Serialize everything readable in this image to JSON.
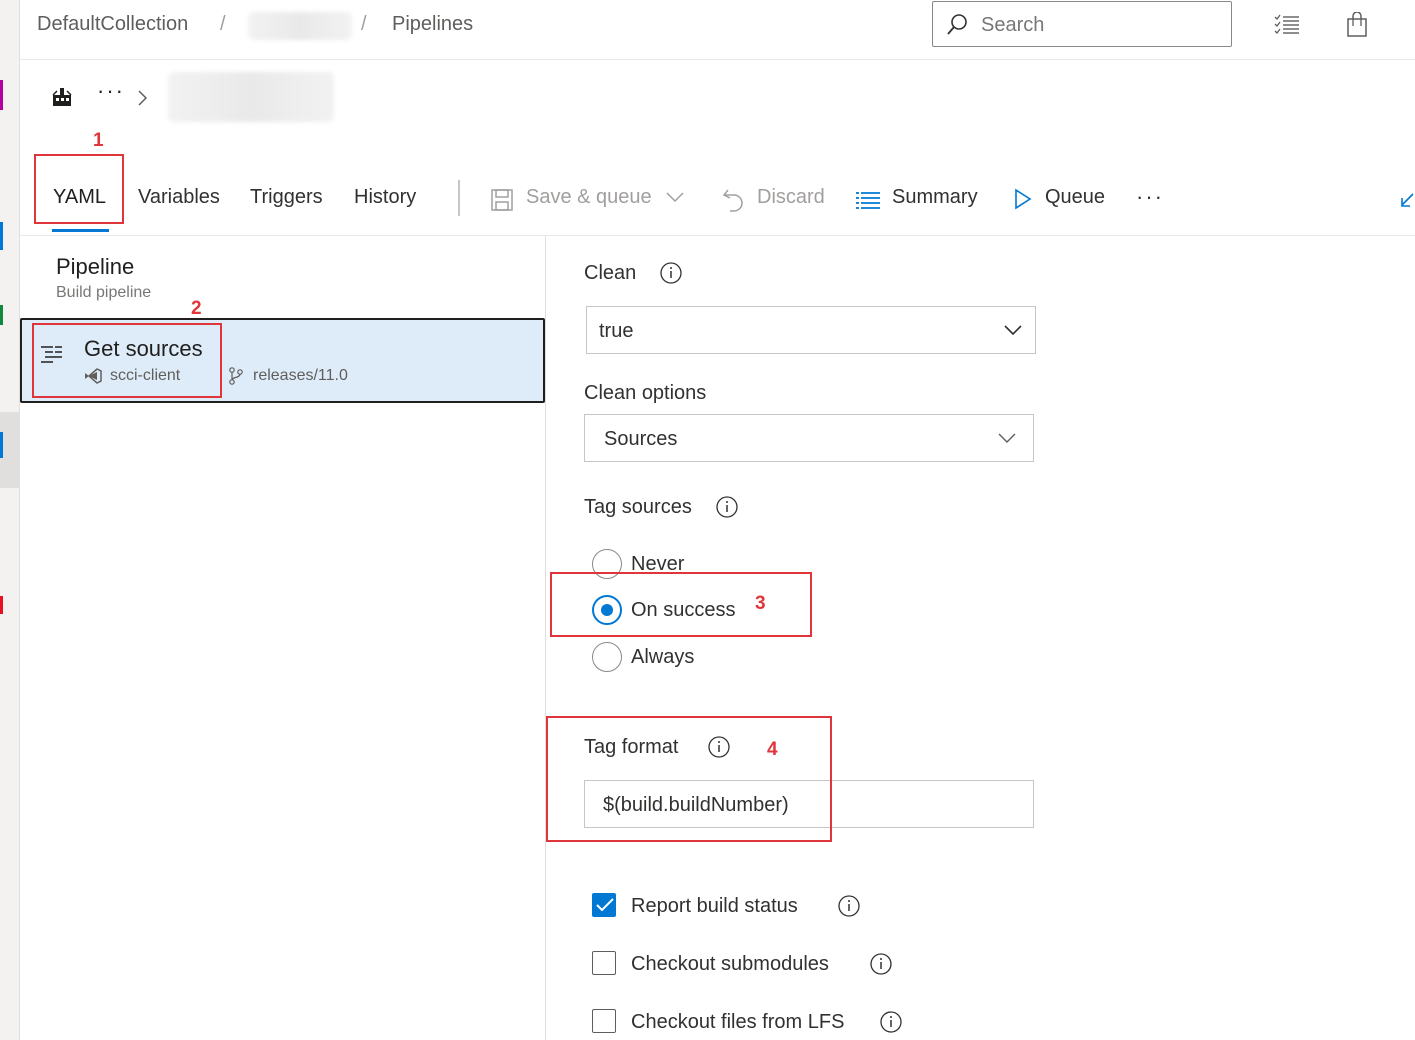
{
  "breadcrumb": {
    "collection": "DefaultCollection",
    "separator": "/",
    "section": "Pipelines"
  },
  "search": {
    "placeholder": "Search"
  },
  "tabs": [
    {
      "label": "YAML",
      "active": true
    },
    {
      "label": "Variables"
    },
    {
      "label": "Triggers"
    },
    {
      "label": "History"
    }
  ],
  "toolbar": {
    "save_queue": "Save & queue",
    "discard": "Discard",
    "summary": "Summary",
    "queue": "Queue",
    "more": "···"
  },
  "title_row": {
    "more": "···"
  },
  "pipeline": {
    "title": "Pipeline",
    "subtitle": "Build pipeline"
  },
  "get_sources": {
    "title": "Get sources",
    "repo": "scci-client",
    "branch": "releases/11.0"
  },
  "form": {
    "clean": {
      "label": "Clean",
      "value": "true"
    },
    "clean_options": {
      "label": "Clean options",
      "value": "Sources"
    },
    "tag_sources": {
      "label": "Tag sources",
      "options": [
        "Never",
        "On success",
        "Always"
      ],
      "selected": "On success"
    },
    "tag_format": {
      "label": "Tag format",
      "value": "$(build.buildNumber)"
    },
    "checkboxes": [
      {
        "label": "Report build status",
        "checked": true
      },
      {
        "label": "Checkout submodules",
        "checked": false
      },
      {
        "label": "Checkout files from LFS",
        "checked": false
      }
    ]
  },
  "annotations": [
    "1",
    "2",
    "3",
    "4"
  ],
  "colors": {
    "accent": "#0078d4",
    "annotation": "#e0353b",
    "selected_bg": "#deecf9"
  }
}
